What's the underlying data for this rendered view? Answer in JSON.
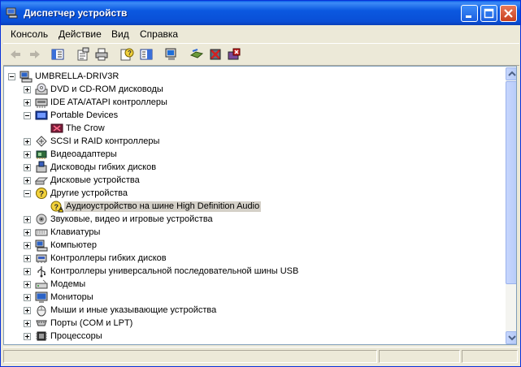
{
  "window": {
    "title": "Диспетчер устройств"
  },
  "menu": [
    "Консоль",
    "Действие",
    "Вид",
    "Справка"
  ],
  "toolbar_icons": [
    "back-icon",
    "forward-icon",
    "console-tree-icon",
    "properties-icon",
    "print-icon",
    "help-icon",
    "details-icon",
    "scan-hardware-icon",
    "update-driver-icon",
    "disable-icon",
    "uninstall-icon"
  ],
  "tree": {
    "root": "UMBRELLA-DRIV3R",
    "items": [
      {
        "label": "DVD и CD-ROM дисководы",
        "expanded": false,
        "icon": "cdrom-icon"
      },
      {
        "label": "IDE ATA/ATAPI контроллеры",
        "expanded": false,
        "icon": "ide-controller-icon"
      },
      {
        "label": "Portable Devices",
        "expanded": true,
        "icon": "portable-device-icon",
        "children": [
          {
            "label": "The Crow",
            "icon": "media-player-icon"
          }
        ]
      },
      {
        "label": "SCSI и RAID контроллеры",
        "expanded": false,
        "icon": "scsi-icon"
      },
      {
        "label": "Видеоадаптеры",
        "expanded": false,
        "icon": "display-adapter-icon"
      },
      {
        "label": "Дисководы гибких дисков",
        "expanded": false,
        "icon": "floppy-drive-icon"
      },
      {
        "label": "Дисковые устройства",
        "expanded": false,
        "icon": "disk-drive-icon"
      },
      {
        "label": "Другие устройства",
        "expanded": true,
        "icon": "unknown-device-icon",
        "children": [
          {
            "label": "Аудиоустройство на шине High Definition Audio",
            "icon": "warning-device-icon",
            "selected": true
          }
        ]
      },
      {
        "label": "Звуковые, видео и игровые устройства",
        "expanded": false,
        "icon": "sound-icon"
      },
      {
        "label": "Клавиатуры",
        "expanded": false,
        "icon": "keyboard-icon"
      },
      {
        "label": "Компьютер",
        "expanded": false,
        "icon": "computer-icon"
      },
      {
        "label": "Контроллеры гибких дисков",
        "expanded": false,
        "icon": "floppy-controller-icon"
      },
      {
        "label": "Контроллеры универсальной последовательной шины USB",
        "expanded": false,
        "icon": "usb-icon"
      },
      {
        "label": "Модемы",
        "expanded": false,
        "icon": "modem-icon"
      },
      {
        "label": "Мониторы",
        "expanded": false,
        "icon": "monitor-icon"
      },
      {
        "label": "Мыши и иные указывающие устройства",
        "expanded": false,
        "icon": "mouse-icon"
      },
      {
        "label": "Порты (COM и LPT)",
        "expanded": false,
        "icon": "port-icon"
      },
      {
        "label": "Процессоры",
        "expanded": false,
        "icon": "processor-icon"
      }
    ]
  },
  "scrollbar": {
    "position": 0
  }
}
